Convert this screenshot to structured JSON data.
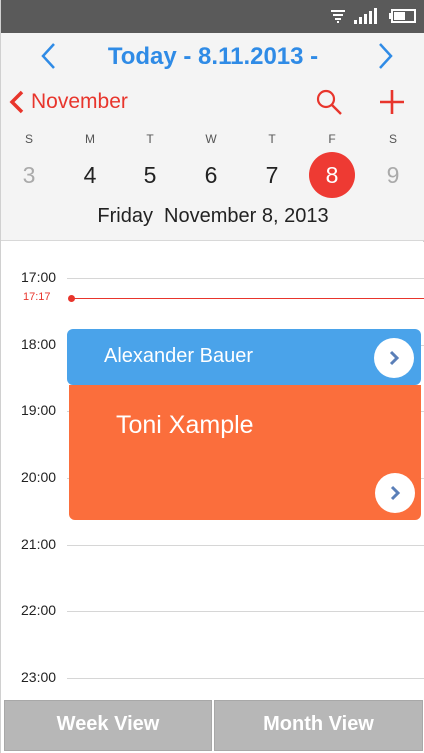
{
  "colors": {
    "accent_blue": "#2f8be6",
    "accent_red": "#e8352c",
    "event_blue": "#4aa3ea",
    "event_orange": "#fb6e3c",
    "status_bar": "#5a5a5a"
  },
  "status_bar": {
    "icons": [
      "wifi-icon",
      "signal-icon",
      "battery-icon"
    ]
  },
  "header": {
    "title": "Today - 8.11.2013 -",
    "prev_icon": "chevron-left-icon",
    "next_icon": "chevron-right-icon"
  },
  "month_bar": {
    "back_label": "November",
    "search_icon": "search-icon",
    "add_icon": "plus-icon"
  },
  "week": {
    "day_letters": [
      "S",
      "M",
      "T",
      "W",
      "T",
      "F",
      "S"
    ],
    "day_numbers": [
      "3",
      "4",
      "5",
      "6",
      "7",
      "8",
      "9"
    ],
    "selected_index": 5,
    "full_date": "Friday  November 8, 2013"
  },
  "timeline": {
    "hours": [
      "17:00",
      "18:00",
      "19:00",
      "20:00",
      "21:00",
      "22:00",
      "23:00"
    ],
    "now_label": "17:17",
    "events": [
      {
        "title": "Alexander Bauer",
        "color": "blue"
      },
      {
        "title": "Toni Xample",
        "color": "orange"
      }
    ]
  },
  "bottom_bar": {
    "week_view": "Week View",
    "month_view": "Month View"
  }
}
